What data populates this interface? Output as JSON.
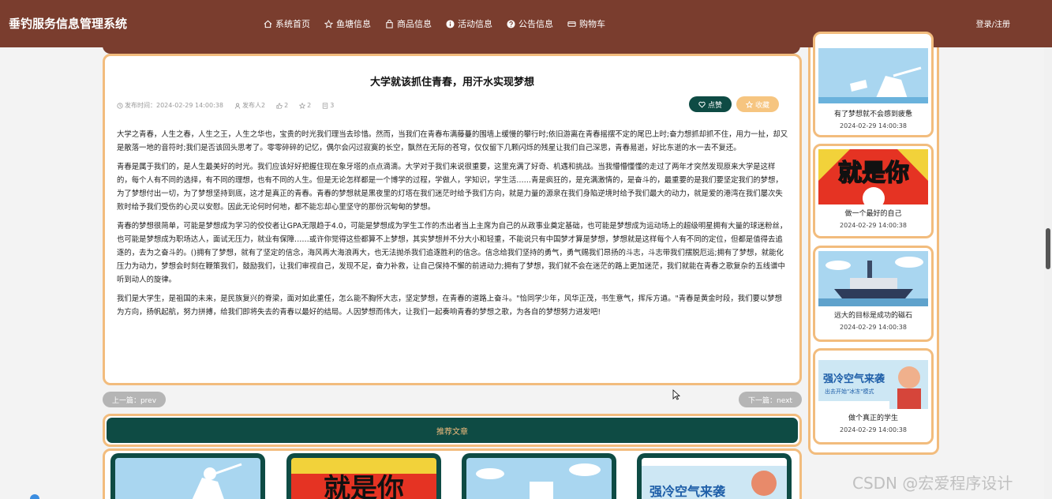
{
  "header": {
    "logo": "垂钓服务信息管理系统",
    "nav": [
      {
        "label": "系统首页",
        "icon": "home-icon"
      },
      {
        "label": "鱼塘信息",
        "icon": "star-icon"
      },
      {
        "label": "商品信息",
        "icon": "bag-icon"
      },
      {
        "label": "活动信息",
        "icon": "info-icon"
      },
      {
        "label": "公告信息",
        "icon": "question-icon"
      },
      {
        "label": "购物车",
        "icon": "cart-icon"
      }
    ],
    "login": "登录/注册"
  },
  "article": {
    "title": "大学就该抓住青春，用汗水实现梦想",
    "meta": {
      "time": "发布时间：2024-02-29 14:00:38",
      "author": "发布人2",
      "likes": "2",
      "favs": "2",
      "views": "3"
    },
    "like_label": "点赞",
    "fav_label": "收藏",
    "paragraphs": [
      "大学之青春，人生之春，人生之王，人生之华也，宝贵的时光我们理当去珍惜。然而，当我们在青春布满藤蔓的围墙上缓慢的攀行时;依旧游离在青春摇摆不定的尾巴上时;奋力想抓却抓不住，用力一扯，却又是散落一地的音符时;我们是否该回头思考了。零零碎碎的记忆，偶尔会闪过寂寞的长空，飘然在无际的苍穹，仅仅留下几颗闪烁的残星让我们自己深思，青春易逝，好比东逝的水一去不复还。",
      "青春是属于我们的，是人生最美好的时光。我们应该好好把握住现在象牙塔的点点滴滴。大学对于我们来说很重要，这里充满了好奇、机遇和挑战。当我懵懵懂懂的走过了两年才突然发现原来大学是这样的，每个人有不同的选择，有不同的理想，也有不同的人生。但是无论怎样都是一个博学的过程，学做人，学知识，学生活……青是疯狂的，是充满激情的，是奋斗的，最重要的是我们要坚定我们的梦想，为了梦想付出一切，为了梦想坚持到底，这才是真正的青春。青春的梦想就是黑夜里的灯塔在我们迷茫时给予我们方向，就是力量的源泉在我们身陷逆境时给予我们最大的动力，就是爱的港湾在我们屡次失败时给予我们受伤的心灵以安慰。因此无论何时何地，都不能忘却心里坚守的那份沉甸甸的梦想。",
      "青春的梦想很简单，可能是梦想成为学习的佼佼者让GPA无限趋于4.0，可能是梦想成为学生工作的杰出者当上主席为自己的从政事业奠定基础，也可能是梦想成为运动场上的超级明星拥有大量的球迷粉丝，也可能是梦想成为职场达人，面试无压力，就业有保障……或许你觉得这些都算不上梦想，其实梦想并不分大小和轻重，不能说只有中国梦才算是梦想，梦想就是这样每个人有不同的定位，但都是值得去追逐的，去为之奋斗的。()拥有了梦想，就有了坚定的信念，海风再大海浪再大，也无法抛杀我们追逐胜利的信念。信念给我们坚持的勇气，勇气赐我们昂扬的斗志，斗志带我们摆脱厄运;拥有了梦想，就能化压力为动力，梦想会时刻在鞭策我们，鼓励我们，让我们审视自己，发现不足，奋力补救，让自己保持不懈的前进动力;拥有了梦想，我们就不会在迷茫的路上更加迷茫，我们就能在青春之歌复杂的五线谱中听到动人的旋律。",
      "我们是大学生，是祖国的未来，是民族复兴的脊梁，面对如此重任，怎么能不胸怀大志，坚定梦想，在青春的道路上奋斗。\"恰同学少年，风华正茂，书生意气，挥斥方遒。\"青春是黄金时段，我们要以梦想为方向，扬帆起航，努力拼搏，给我们即将失去的青春以最好的结局。人因梦想而伟大，让我们一起奏响青春的梦想之歌，为各自的梦想努力进发吧!"
    ]
  },
  "pager": {
    "prev": "上一篇：prev",
    "next": "下一篇：next"
  },
  "recommend": {
    "title": "推荐文章"
  },
  "sidebar": {
    "items": [
      {
        "title": "有了梦想就不会感到疲惫",
        "date": "2024-02-29 14:00:38",
        "image": "girl-book-illustration"
      },
      {
        "title": "做一个最好的自己",
        "date": "2024-02-29 14:00:38",
        "image": "jiushini-poster"
      },
      {
        "title": "远大的目标是成功的磁石",
        "date": "2024-02-29 14:00:38",
        "image": "ship-illustration"
      },
      {
        "title": "做个真正的学生",
        "date": "2024-02-29 14:00:38",
        "image": "cold-air-poster"
      }
    ]
  },
  "poster_text": {
    "jiushini": "就是你",
    "cold_air": "强冷空气来袭",
    "cold_air_sub": "出去开始\"冰冻\"模式"
  },
  "watermark": "CSDN @宏爱程序设计"
}
